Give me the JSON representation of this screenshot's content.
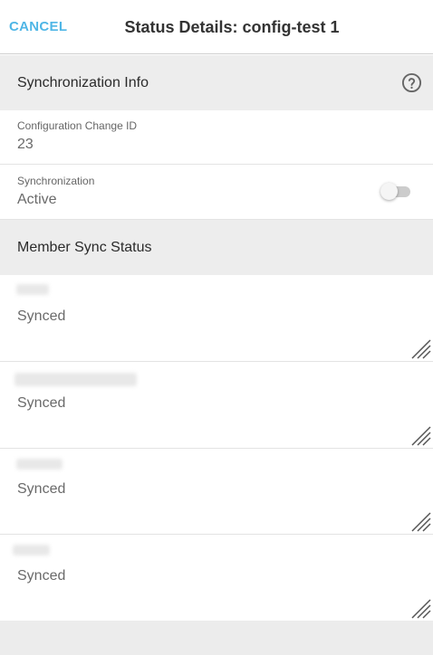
{
  "header": {
    "cancel_label": "CANCEL",
    "title": "Status Details: config-test 1"
  },
  "sync_info": {
    "section_label": "Synchronization Info",
    "help_icon": "help-circle-icon",
    "change_id": {
      "label": "Configuration Change ID",
      "value": "23"
    },
    "synchronization": {
      "label": "Synchronization",
      "value": "Active",
      "toggle_on": false
    }
  },
  "member_sync": {
    "section_label": "Member Sync Status",
    "members": [
      {
        "status": "Synced"
      },
      {
        "status": "Synced"
      },
      {
        "status": "Synced"
      },
      {
        "status": "Synced"
      }
    ]
  },
  "colors": {
    "accent": "#4fb6e6",
    "section_bg": "#ededed",
    "divider": "#e3e3e3"
  }
}
